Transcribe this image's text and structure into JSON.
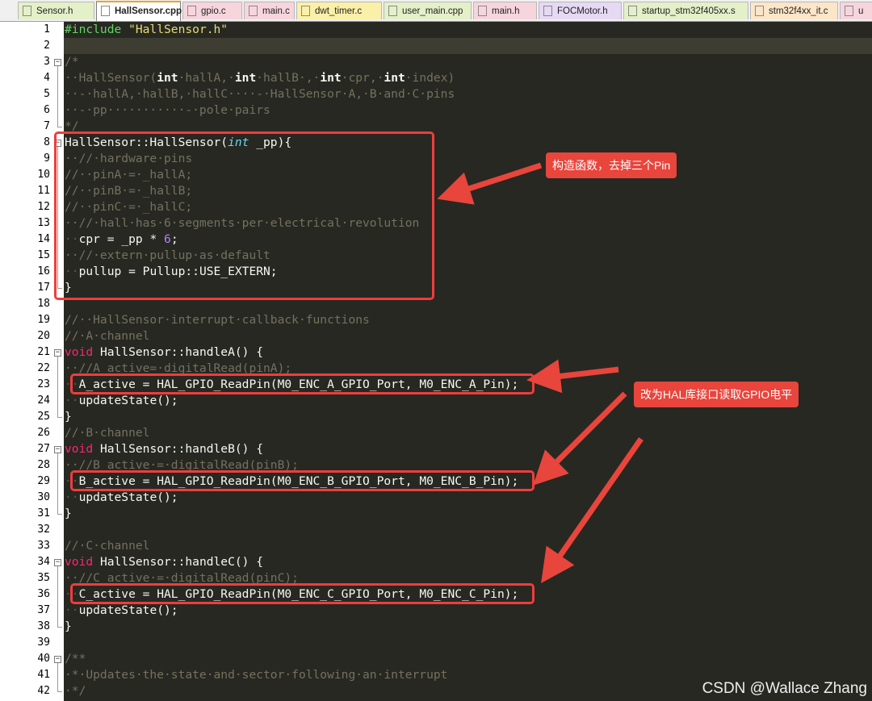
{
  "tabs": [
    {
      "label": "Sensor.h",
      "color": "#e4f0c8",
      "active": false
    },
    {
      "label": "HallSensor.cpp",
      "color": "#ffffff",
      "active": true
    },
    {
      "label": "gpio.c",
      "color": "#f7d5dd",
      "active": false
    },
    {
      "label": "main.c",
      "color": "#f7d5dd",
      "active": false
    },
    {
      "label": "dwt_timer.c",
      "color": "#fbf0a8",
      "active": false
    },
    {
      "label": "user_main.cpp",
      "color": "#e4f0c8",
      "active": false
    },
    {
      "label": "main.h",
      "color": "#f7d5dd",
      "active": false
    },
    {
      "label": "FOCMotor.h",
      "color": "#e6d9f3",
      "active": false
    },
    {
      "label": "startup_stm32f405xx.s",
      "color": "#e4f0c8",
      "active": false
    },
    {
      "label": "stm32f4xx_it.c",
      "color": "#fde6c8",
      "active": false
    },
    {
      "label": "u",
      "color": "#f7d5dd",
      "active": false
    }
  ],
  "editor": {
    "highlighted_line": 2,
    "lines": [
      {
        "n": "1",
        "spans": [
          [
            "dir",
            "#include "
          ],
          [
            "str",
            "\"HallSensor.h\""
          ]
        ]
      },
      {
        "n": "2",
        "spans": []
      },
      {
        "n": "3",
        "spans": [
          [
            "com",
            "/*"
          ]
        ]
      },
      {
        "n": "4",
        "spans": [
          [
            "com",
            "··HallSensor("
          ],
          [
            "bold",
            "int"
          ],
          [
            "com",
            "·hallA,·"
          ],
          [
            "bold",
            "int"
          ],
          [
            "com",
            "·hallB·,·"
          ],
          [
            "bold",
            "int"
          ],
          [
            "com",
            "·cpr,·"
          ],
          [
            "bold",
            "int"
          ],
          [
            "com",
            "·index)"
          ]
        ]
      },
      {
        "n": "5",
        "spans": [
          [
            "com",
            "··-·hallA,·hallB,·hallC····-·HallSensor·A,·B·and·C·pins"
          ]
        ]
      },
      {
        "n": "6",
        "spans": [
          [
            "com",
            "··-·pp···········-·pole·pairs"
          ]
        ]
      },
      {
        "n": "7",
        "spans": [
          [
            "com",
            "*/"
          ]
        ]
      },
      {
        "n": "8",
        "spans": [
          [
            "txt",
            "HallSensor::HallSensor("
          ],
          [
            "type",
            "int"
          ],
          [
            "txt",
            " _pp){"
          ]
        ]
      },
      {
        "n": "9",
        "spans": [
          [
            "com",
            "··//·hardware·pins"
          ]
        ]
      },
      {
        "n": "10",
        "spans": [
          [
            "com",
            "//··pinA·=·_hallA;"
          ]
        ]
      },
      {
        "n": "11",
        "spans": [
          [
            "com",
            "//··pinB·=·_hallB;"
          ]
        ]
      },
      {
        "n": "12",
        "spans": [
          [
            "com",
            "//··pinC·=·_hallC;"
          ]
        ]
      },
      {
        "n": "13",
        "spans": [
          [
            "com",
            "··//·hall·has·6·segments·per·electrical·revolution"
          ]
        ]
      },
      {
        "n": "14",
        "spans": [
          [
            "ws",
            "··"
          ],
          [
            "txt",
            "cpr = _pp * "
          ],
          [
            "num",
            "6"
          ],
          [
            "txt",
            ";"
          ]
        ]
      },
      {
        "n": "15",
        "spans": [
          [
            "com",
            "··//·extern·pullup·as·default"
          ]
        ]
      },
      {
        "n": "16",
        "spans": [
          [
            "ws",
            "··"
          ],
          [
            "txt",
            "pullup = Pullup::USE_EXTERN;"
          ]
        ]
      },
      {
        "n": "17",
        "spans": [
          [
            "txt",
            "}"
          ]
        ]
      },
      {
        "n": "18",
        "spans": []
      },
      {
        "n": "19",
        "spans": [
          [
            "com",
            "//··HallSensor·interrupt·callback·functions"
          ]
        ]
      },
      {
        "n": "20",
        "spans": [
          [
            "com",
            "//·A·channel"
          ]
        ]
      },
      {
        "n": "21",
        "spans": [
          [
            "kw",
            "void"
          ],
          [
            "txt",
            " HallSensor::handleA() {"
          ]
        ]
      },
      {
        "n": "22",
        "spans": [
          [
            "com",
            "··//A_active=·digitalRead(pinA);"
          ]
        ]
      },
      {
        "n": "23",
        "spans": [
          [
            "ws",
            "··"
          ],
          [
            "txt",
            "A_active = HAL_GPIO_ReadPin(M0_ENC_A_GPIO_Port, M0_ENC_A_Pin);"
          ]
        ]
      },
      {
        "n": "24",
        "spans": [
          [
            "ws",
            "··"
          ],
          [
            "txt",
            "updateState();"
          ]
        ]
      },
      {
        "n": "25",
        "spans": [
          [
            "txt",
            "}"
          ]
        ]
      },
      {
        "n": "26",
        "spans": [
          [
            "com",
            "//·B·channel"
          ]
        ]
      },
      {
        "n": "27",
        "spans": [
          [
            "kw",
            "void"
          ],
          [
            "txt",
            " HallSensor::handleB() {"
          ]
        ]
      },
      {
        "n": "28",
        "spans": [
          [
            "com",
            "··//B_active·=·digitalRead(pinB);"
          ]
        ]
      },
      {
        "n": "29",
        "spans": [
          [
            "ws",
            "··"
          ],
          [
            "txt",
            "B_active = HAL_GPIO_ReadPin(M0_ENC_B_GPIO_Port, M0_ENC_B_Pin);"
          ]
        ]
      },
      {
        "n": "30",
        "spans": [
          [
            "ws",
            "··"
          ],
          [
            "txt",
            "updateState();"
          ]
        ]
      },
      {
        "n": "31",
        "spans": [
          [
            "txt",
            "}"
          ]
        ]
      },
      {
        "n": "32",
        "spans": []
      },
      {
        "n": "33",
        "spans": [
          [
            "com",
            "//·C·channel"
          ]
        ]
      },
      {
        "n": "34",
        "spans": [
          [
            "kw",
            "void"
          ],
          [
            "txt",
            " HallSensor::handleC() {"
          ]
        ]
      },
      {
        "n": "35",
        "spans": [
          [
            "com",
            "··//C_active·=·digitalRead(pinC);"
          ]
        ]
      },
      {
        "n": "36",
        "spans": [
          [
            "ws",
            "··"
          ],
          [
            "txt",
            "C_active = HAL_GPIO_ReadPin(M0_ENC_C_GPIO_Port, M0_ENC_C_Pin);"
          ]
        ]
      },
      {
        "n": "37",
        "spans": [
          [
            "ws",
            "··"
          ],
          [
            "txt",
            "updateState();"
          ]
        ]
      },
      {
        "n": "38",
        "spans": [
          [
            "txt",
            "}"
          ]
        ]
      },
      {
        "n": "39",
        "spans": []
      },
      {
        "n": "40",
        "spans": [
          [
            "com",
            "/**"
          ]
        ]
      },
      {
        "n": "41",
        "spans": [
          [
            "com",
            "·*·Updates·the·state·and·sector·following·an·interrupt"
          ]
        ]
      },
      {
        "n": "42",
        "spans": [
          [
            "com",
            "·*/"
          ]
        ]
      }
    ]
  },
  "annotations": {
    "callout_constructor": "构造函数，去掉三个Pin",
    "callout_hal": "改为HAL库接口读取GPIO电平",
    "accent_color": "#e8453c"
  },
  "watermark": "CSDN @Wallace Zhang"
}
